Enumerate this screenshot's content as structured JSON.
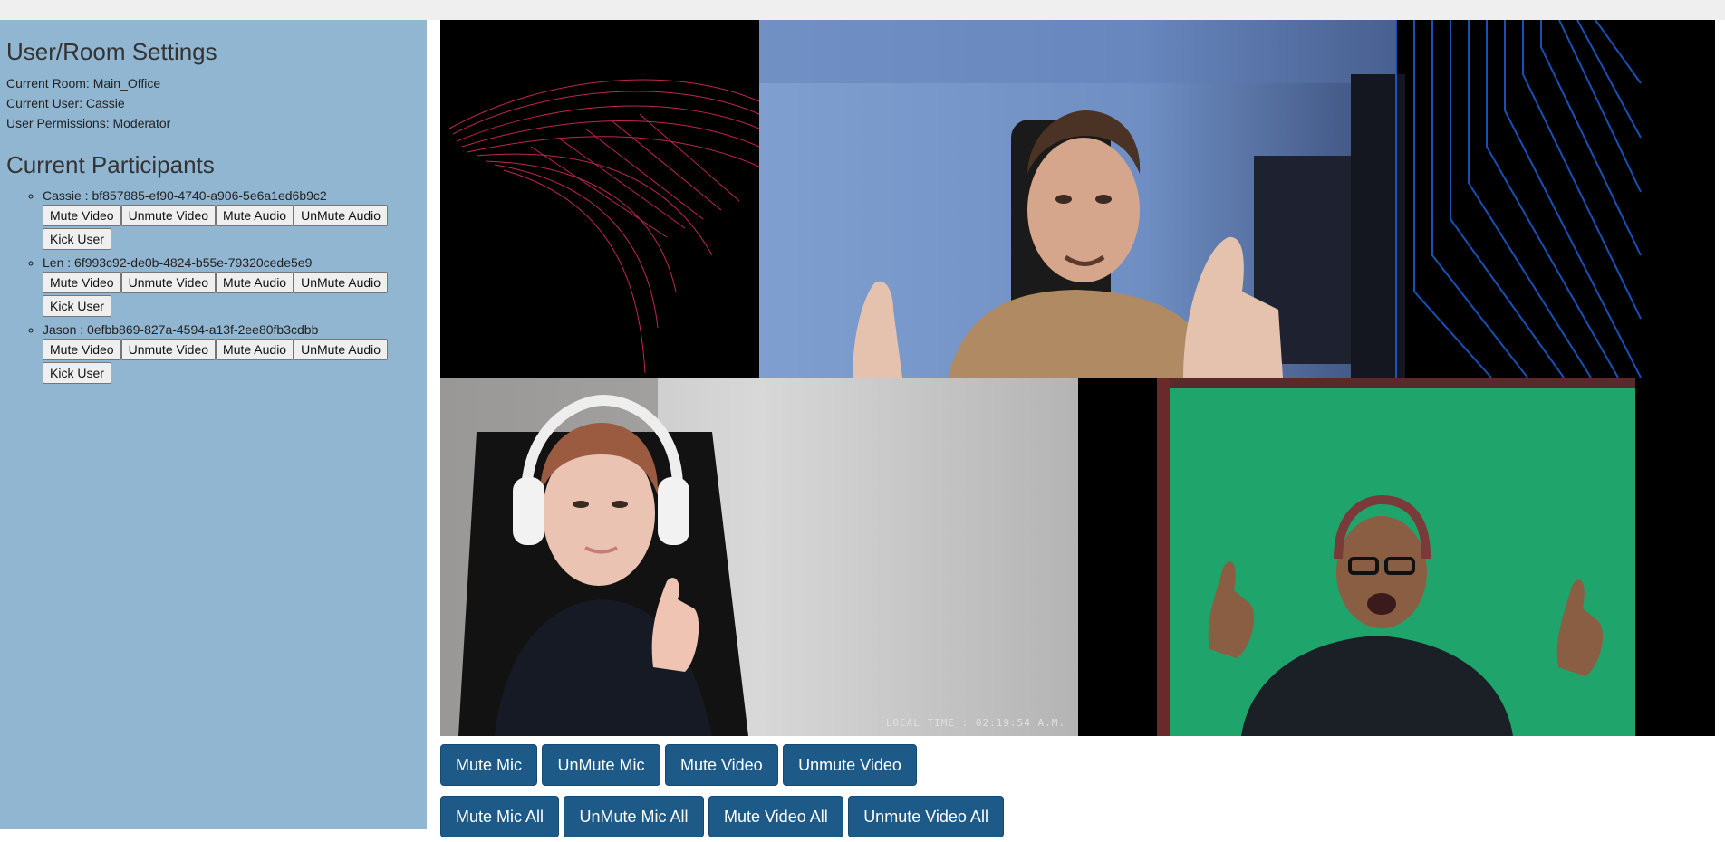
{
  "settings": {
    "heading": "User/Room Settings",
    "current_room": "Current Room: Main_Office",
    "current_user": "Current User: Cassie",
    "permissions": "User Permissions: Moderator"
  },
  "participants_heading": "Current Participants",
  "participant_buttons": {
    "mute_video": "Mute Video",
    "unmute_video": "Unmute Video",
    "mute_audio": "Mute Audio",
    "unmute_audio": "UnMute Audio",
    "kick": "Kick User"
  },
  "participants": [
    {
      "label": "Cassie : bf857885-ef90-4740-a906-5e6a1ed6b9c2"
    },
    {
      "label": "Len : 6f993c92-de0b-4824-b55e-79320cede5e9"
    },
    {
      "label": "Jason : 0efbb869-827a-4594-a13f-2ee80fb3cdbb"
    }
  ],
  "video": {
    "local_time": "LOCAL TIME : 02:19:54 A.M."
  },
  "controls": {
    "row1": [
      "Mute Mic",
      "UnMute Mic",
      "Mute Video",
      "Unmute Video"
    ],
    "row2": [
      "Mute Mic All",
      "UnMute Mic All",
      "Mute Video All",
      "Unmute Video All"
    ]
  },
  "colors": {
    "sidebar_bg": "#91b6d1",
    "control_button_bg": "#1e5a87",
    "top_bar_bg": "#efefef"
  }
}
